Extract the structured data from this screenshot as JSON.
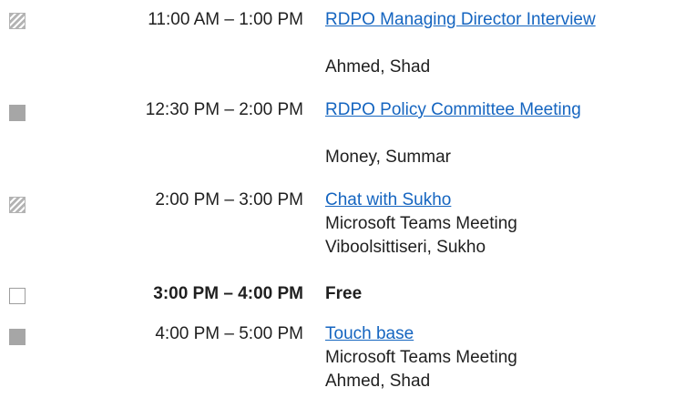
{
  "events": [
    {
      "status": "tentative",
      "time": "11:00 AM – 1:00 PM",
      "subject": "RDPO Managing Director Interview",
      "location": "",
      "organizer": "Ahmed, Shad"
    },
    {
      "status": "busy",
      "time": "12:30 PM – 2:00 PM",
      "subject": "RDPO Policy Committee Meeting",
      "location": "",
      "organizer": "Money, Summar"
    },
    {
      "status": "tentative",
      "time": "2:00 PM – 3:00 PM",
      "subject": "Chat with Sukho",
      "location": "Microsoft Teams Meeting",
      "organizer": "Viboolsittiseri, Sukho"
    },
    {
      "status": "free",
      "time": "3:00 PM – 4:00 PM",
      "subject": "Free",
      "location": "",
      "organizer": ""
    },
    {
      "status": "busy",
      "time": "4:00 PM – 5:00 PM",
      "subject": "Touch base",
      "location": "Microsoft Teams Meeting",
      "organizer": "Ahmed, Shad"
    }
  ]
}
